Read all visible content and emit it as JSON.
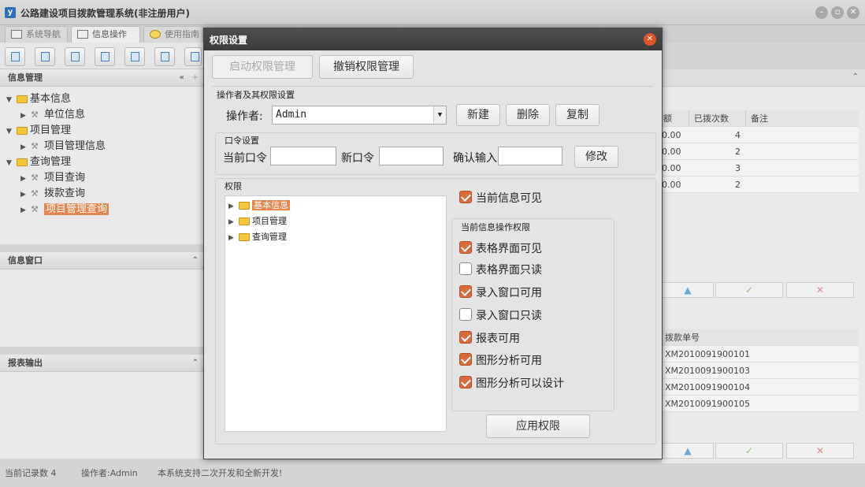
{
  "app": {
    "title": "公路建设项目拨款管理系统(非注册用户)",
    "icon_glyph": "y"
  },
  "tabs": [
    {
      "label": "系统导航"
    },
    {
      "label": "信息操作"
    },
    {
      "label": "使用指南"
    }
  ],
  "left": {
    "info_mgmt": {
      "title": "信息管理",
      "tree": [
        {
          "label": "基本信息",
          "level": 0,
          "type": "folder"
        },
        {
          "label": "单位信息",
          "level": 1,
          "type": "leaf"
        },
        {
          "label": "项目管理",
          "level": 0,
          "type": "folder"
        },
        {
          "label": "项目管理信息",
          "level": 1,
          "type": "leaf"
        },
        {
          "label": "查询管理",
          "level": 0,
          "type": "folder"
        },
        {
          "label": "项目查询",
          "level": 1,
          "type": "leaf"
        },
        {
          "label": "拨款查询",
          "level": 1,
          "type": "leaf"
        },
        {
          "label": "项目管理查询",
          "level": 1,
          "type": "leaf",
          "selected": true
        }
      ]
    },
    "info_window": {
      "title": "信息窗口"
    },
    "report": {
      "title": "报表输出"
    }
  },
  "right": {
    "grid1": {
      "headers": [
        "额",
        "已拨次数",
        "备注"
      ],
      "rows": [
        [
          "0.00",
          "4",
          ""
        ],
        [
          "0.00",
          "2",
          ""
        ],
        [
          "0.00",
          "3",
          ""
        ],
        [
          "0.00",
          "2",
          ""
        ]
      ]
    },
    "grid2": {
      "headers": [
        "拨款单号"
      ],
      "rows": [
        "XM2010091900101",
        "XM2010091900103",
        "XM2010091900104",
        "XM2010091900105"
      ]
    },
    "action_buttons": {
      "up": "▲",
      "ok": "✓",
      "cancel": "✕"
    }
  },
  "status": {
    "record_count": "当前记录数 4",
    "operator": "操作者:Admin",
    "message": "本系统支持二次开发和全新开发!"
  },
  "dialog": {
    "title": "权限设置",
    "enable_btn": "启动权限管理",
    "revoke_btn": "撤销权限管理",
    "operator_group": {
      "title": "操作者及其权限设置",
      "label": "操作者:",
      "value": "Admin",
      "new_btn": "新建",
      "delete_btn": "删除",
      "copy_btn": "复制"
    },
    "password_group": {
      "title": "口令设置",
      "current_label": "当前口令",
      "new_label": "新口令",
      "confirm_label": "确认输入",
      "modify_btn": "修改"
    },
    "permission_group": {
      "title": "权限",
      "tree": [
        {
          "label": "基本信息",
          "selected": true
        },
        {
          "label": "项目管理",
          "selected": false
        },
        {
          "label": "查询管理",
          "selected": false
        }
      ],
      "current_visible": {
        "label": "当前信息可见",
        "checked": true
      },
      "ops_title": "当前信息操作权限",
      "ops": [
        {
          "label": "表格界面可见",
          "checked": true
        },
        {
          "label": "表格界面只读",
          "checked": false
        },
        {
          "label": "录入窗口可用",
          "checked": true
        },
        {
          "label": "录入窗口只读",
          "checked": false
        },
        {
          "label": "报表可用",
          "checked": true
        },
        {
          "label": "图形分析可用",
          "checked": true
        },
        {
          "label": "图形分析可以设计",
          "checked": true
        }
      ],
      "apply_btn": "应用权限"
    }
  },
  "colors": {
    "accent": "#e4864f",
    "checkbox_on": "#d96a3c",
    "dialog_title_bg": "#3b3b3b",
    "close_red": "#e0532b"
  }
}
